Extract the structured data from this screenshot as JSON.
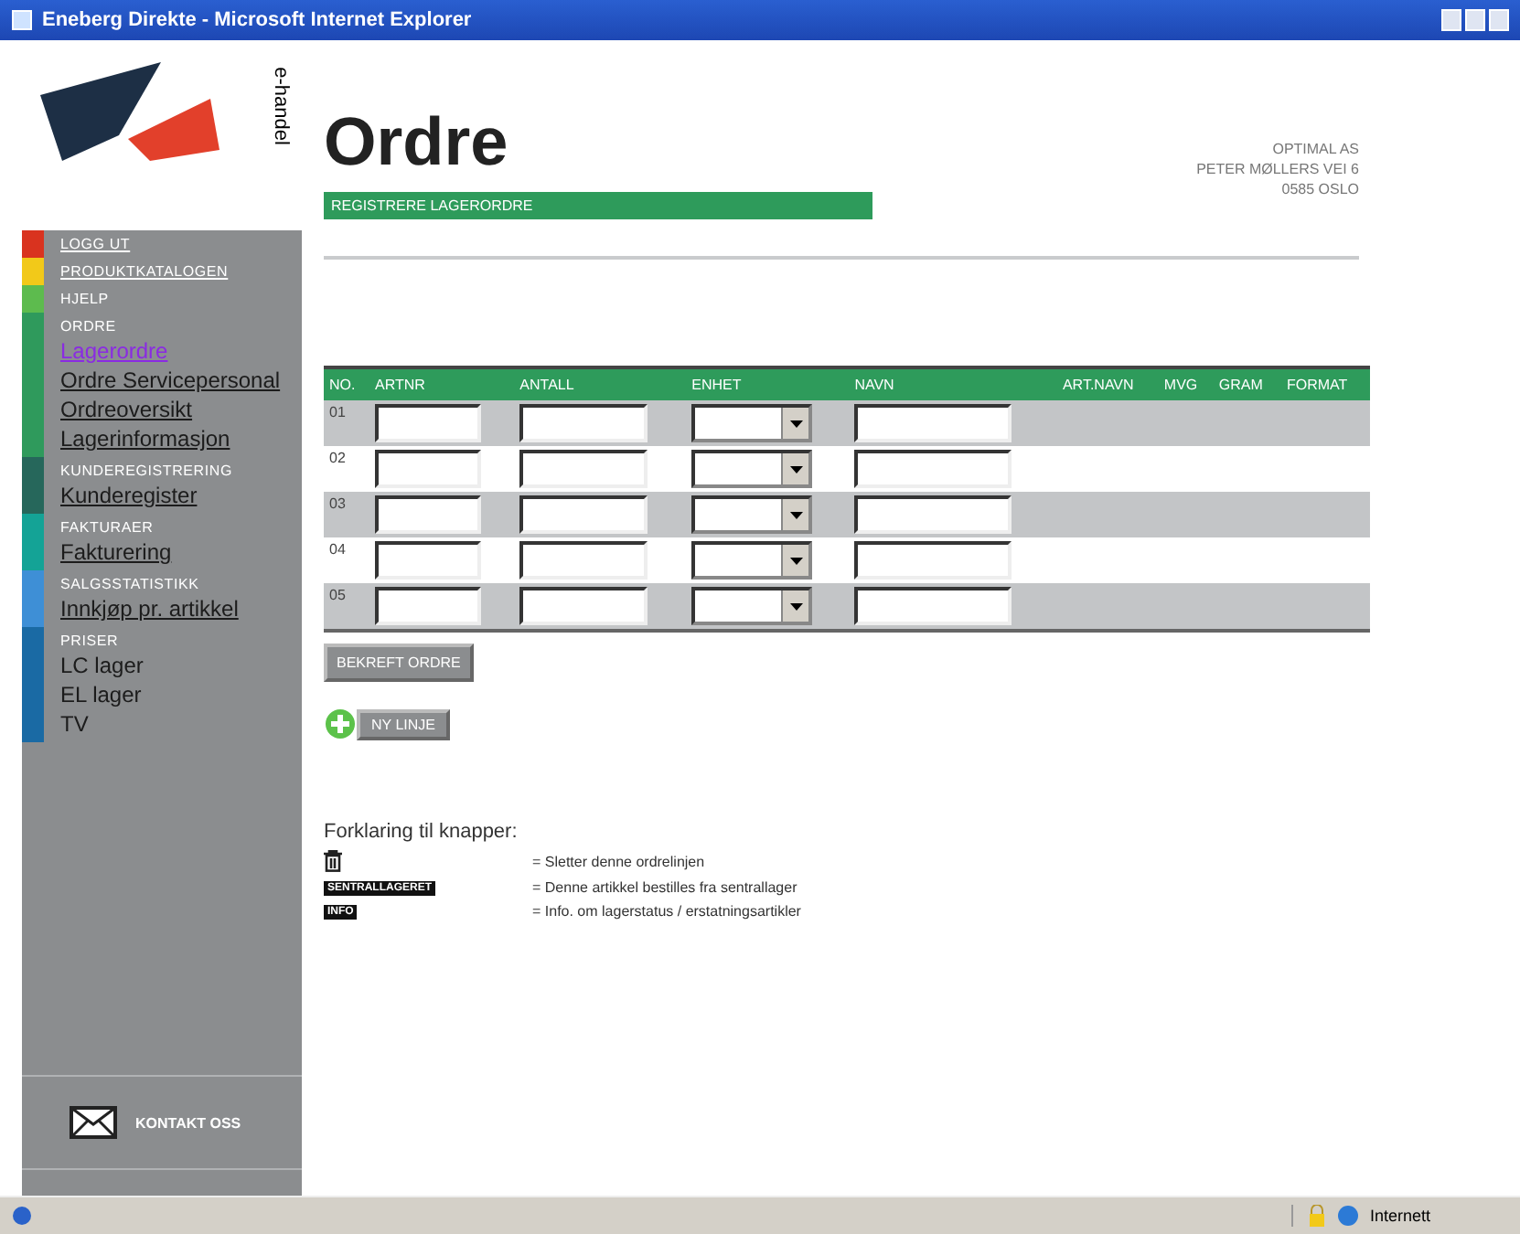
{
  "window": {
    "title": "Eneberg Direkte - Microsoft Internet Explorer"
  },
  "logo": {
    "text": "e-handel"
  },
  "sidebar": {
    "sections": [
      {
        "color": "#d9331f",
        "items": [
          {
            "kind": "heading",
            "label": "LOGG UT",
            "link": true
          }
        ]
      },
      {
        "color": "#f2c919",
        "items": [
          {
            "kind": "heading",
            "label": "PRODUKTKATALOGEN",
            "link": true
          }
        ]
      },
      {
        "color": "#5dbb4e",
        "items": [
          {
            "kind": "heading",
            "label": "HJELP",
            "link": false
          }
        ]
      },
      {
        "color": "#2f9a5c",
        "items": [
          {
            "kind": "heading",
            "label": "ORDRE",
            "link": false
          },
          {
            "kind": "link",
            "label": "Lagerordre",
            "selected": true
          },
          {
            "kind": "link",
            "label": "Ordre Servicepersonal",
            "selected": false
          },
          {
            "kind": "link",
            "label": "Ordreoversikt",
            "selected": false
          },
          {
            "kind": "link",
            "label": "Lagerinformasjon",
            "selected": false
          }
        ]
      },
      {
        "color": "#26675b",
        "items": [
          {
            "kind": "heading",
            "label": "KUNDEREGISTRERING",
            "link": false
          },
          {
            "kind": "link",
            "label": "Kunderegister",
            "selected": false
          }
        ]
      },
      {
        "color": "#14a396",
        "items": [
          {
            "kind": "heading",
            "label": "FAKTURAER",
            "link": false
          },
          {
            "kind": "link",
            "label": "Fakturering",
            "selected": false
          }
        ]
      },
      {
        "color": "#3e8fd6",
        "items": [
          {
            "kind": "heading",
            "label": "SALGSSTATISTIKK",
            "link": false
          },
          {
            "kind": "link",
            "label": "Innkjøp pr. artikkel",
            "selected": false
          }
        ]
      },
      {
        "color": "#1a6aa4",
        "items": [
          {
            "kind": "heading",
            "label": "PRISER",
            "link": false
          },
          {
            "kind": "plain",
            "label": "LC lager"
          },
          {
            "kind": "plain",
            "label": "EL lager"
          },
          {
            "kind": "plain",
            "label": "TV"
          }
        ]
      }
    ],
    "contact": "KONTAKT OSS"
  },
  "page": {
    "title": "Ordre",
    "section_bar": "REGISTRERE LAGERORDRE",
    "address": [
      "OPTIMAL AS",
      "PETER MØLLERS VEI 6",
      "0585 OSLO"
    ]
  },
  "table": {
    "columns": [
      "NO.",
      "ARTNR",
      "ANTALL",
      "ENHET",
      "NAVN",
      "ART.NAVN",
      "MVG",
      "GRAM",
      "FORMAT"
    ],
    "rows": [
      "01",
      "02",
      "03",
      "04",
      "05"
    ]
  },
  "buttons": {
    "confirm": "BEKREFT ORDRE",
    "add": "NY LINJE"
  },
  "legend": {
    "title": "Forklaring til knapper:",
    "items": [
      {
        "kind": "trash",
        "text": "= Sletter denne ordrelinjen"
      },
      {
        "kind": "badge",
        "badge": "SENTRALLAGERET",
        "text": "= Denne artikkel bestilles fra sentrallager"
      },
      {
        "kind": "badge",
        "badge": "INFO",
        "text": "= Info. om lagerstatus / erstatningsartikler"
      }
    ]
  },
  "status_bar": {
    "zone": "Internett"
  }
}
